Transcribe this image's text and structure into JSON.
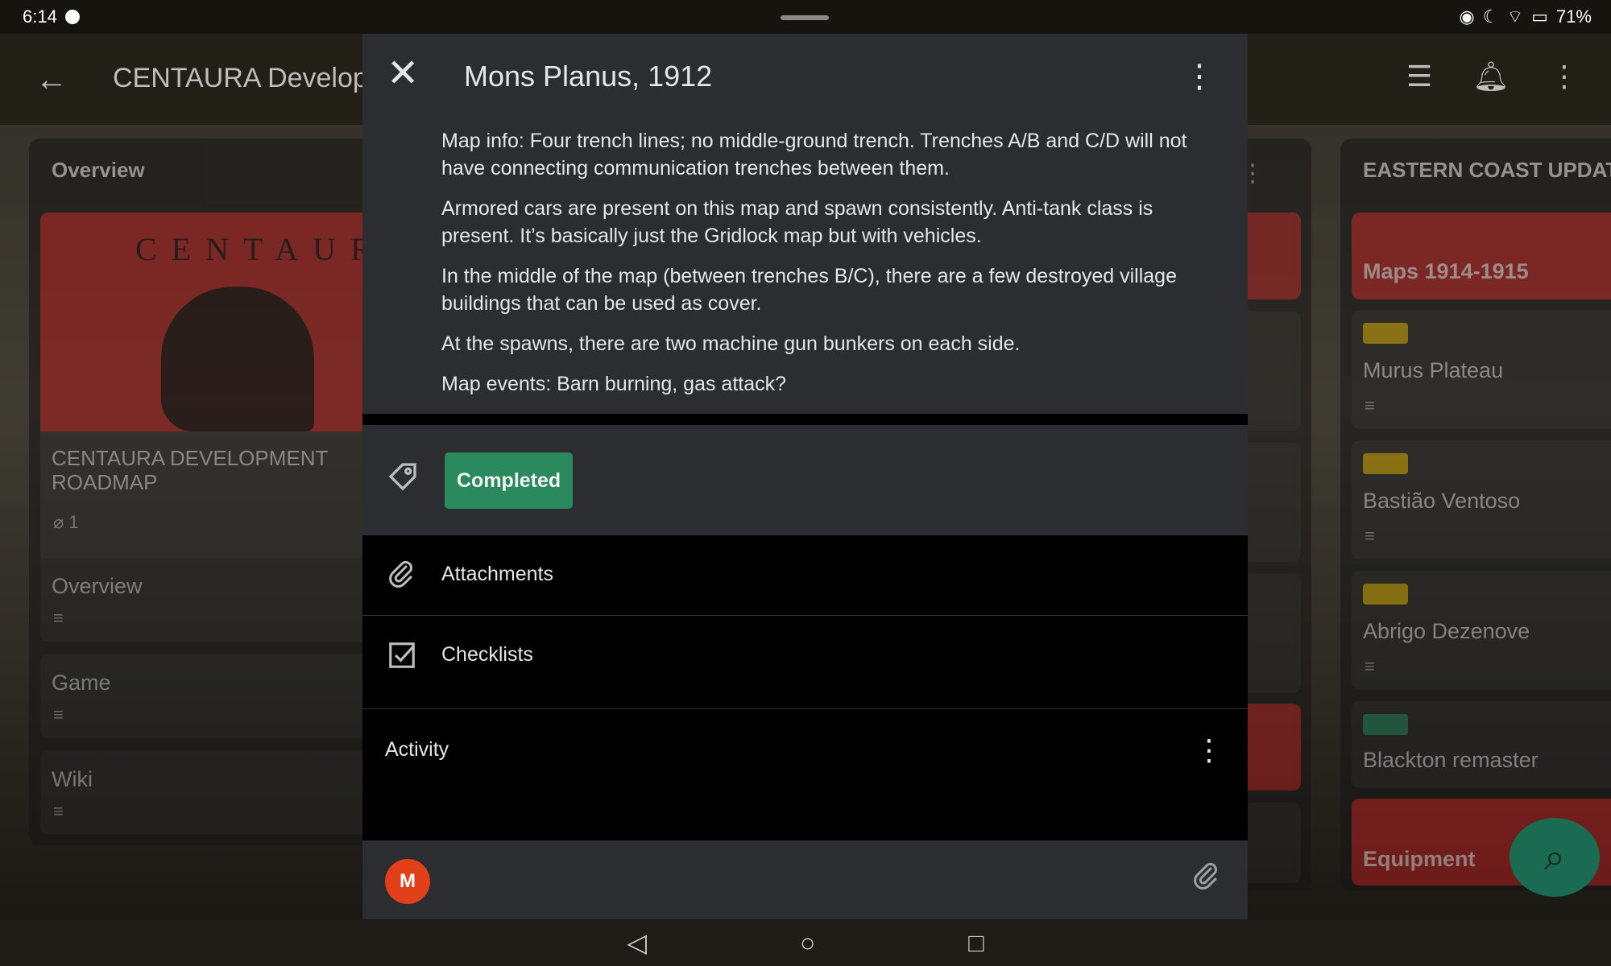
{
  "status_bar": {
    "time": "6:14",
    "battery": "71%"
  },
  "app_bar": {
    "title": "CENTAURA Develop"
  },
  "left_list": {
    "header": "Overview",
    "cover": {
      "image_word": "CENTAURA",
      "title": "CENTAURA DEVELOPMENT ROADMAP",
      "attachments_count": "1"
    },
    "cards": [
      "Overview",
      "Game",
      "Wiki"
    ]
  },
  "right_list": {
    "header": "EASTERN COAST UPDAT",
    "cards": [
      {
        "title": "Maps 1914-1915",
        "style": "red"
      },
      {
        "title": "Murus Plateau",
        "label_color": "#c9a000"
      },
      {
        "title": "Bastião Ventoso",
        "label_color": "#c9a000"
      },
      {
        "title": "Abrigo Dezenove",
        "label_color": "#c9a000"
      },
      {
        "title": "Blackton remaster",
        "label_color": "#1f7a55"
      },
      {
        "title": "Equipment",
        "style": "red"
      }
    ]
  },
  "modal": {
    "title": "Mons Planus, 1912",
    "description": [
      "Map info: Four trench lines; no middle-ground trench. Trenches A/B and C/D will not have connecting communication trenches between them.",
      "Armored cars are present on this map and spawn consistently. Anti-tank class is present. It’s basically just the Gridlock map but with vehicles.",
      "In the middle of the map (between trenches B/C), there are a few destroyed village buildings that can be used as cover.",
      "At the spawns, there are two machine gun bunkers on each side.",
      "Map events: Barn burning, gas attack?"
    ],
    "label": "Completed",
    "label_color": "#2a8a5e",
    "attachments_label": "Attachments",
    "checklists_label": "Checklists",
    "activity_label": "Activity",
    "avatar_initial": "M"
  },
  "colors": {
    "accent_red": "#b11d1d",
    "avatar": "#e2401b",
    "fab": "#1a6b52"
  }
}
